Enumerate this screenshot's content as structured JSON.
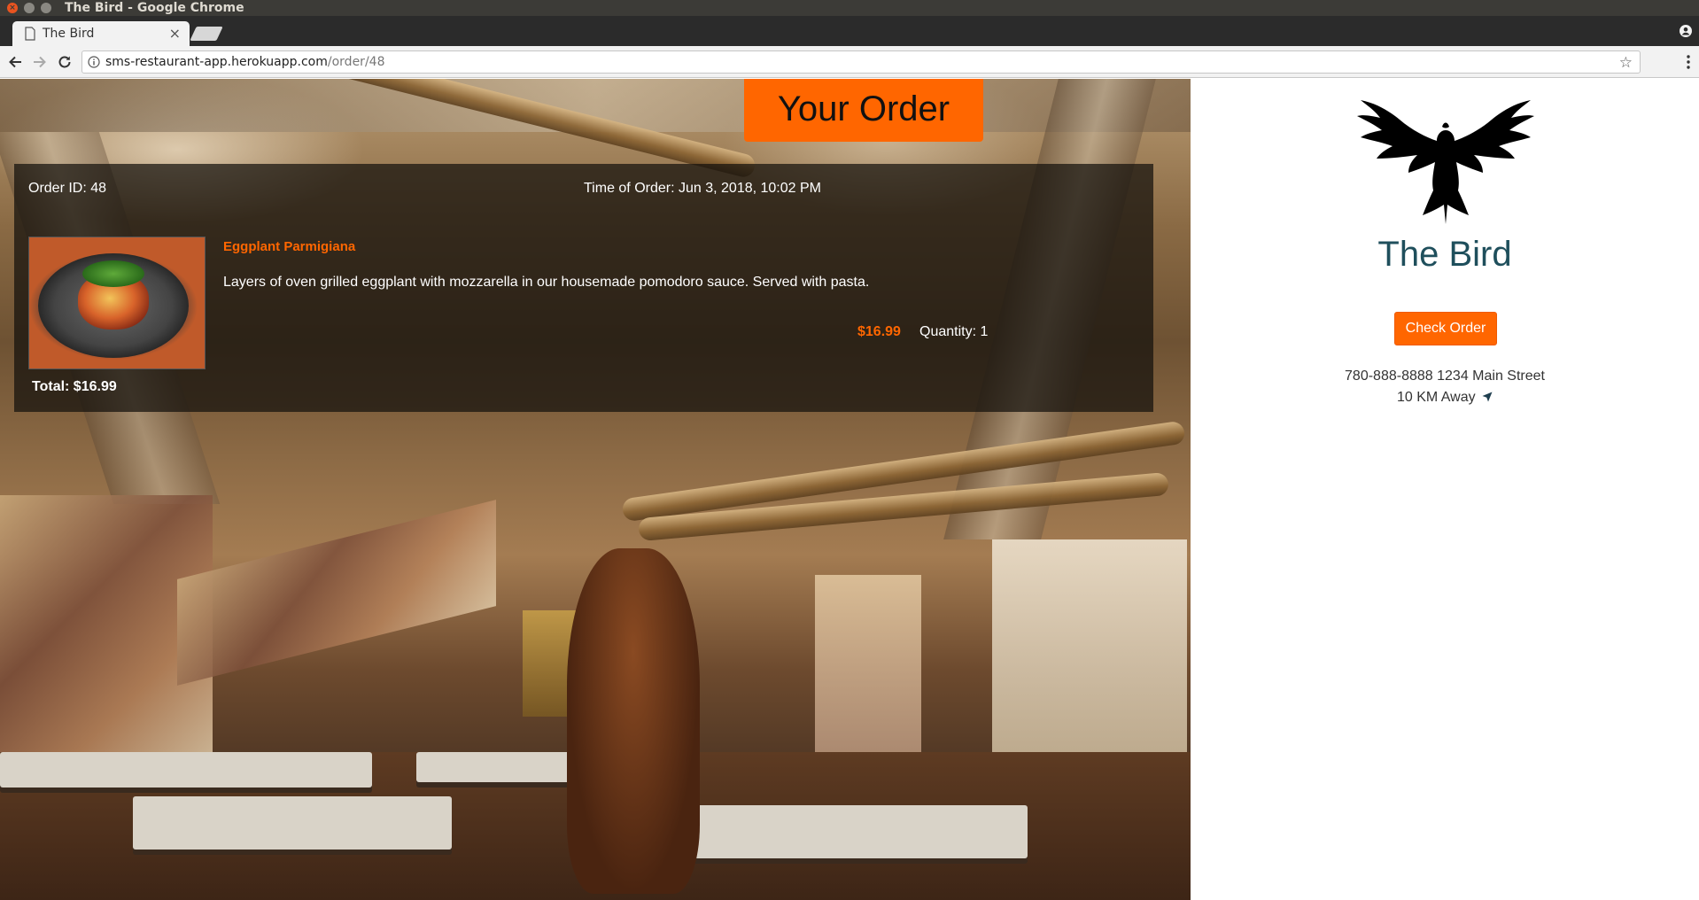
{
  "window": {
    "title": "The Bird - Google Chrome"
  },
  "browser": {
    "tab_title": "The Bird",
    "tab_close": "×",
    "url_host": "sms-restaurant-app.herokuapp.com",
    "url_path": "/order/48",
    "star": "☆"
  },
  "hero": {
    "button_label": "Your Order"
  },
  "order": {
    "id_label": "Order ID: 48",
    "time_label": "Time of Order: Jun 3, 2018, 10:02 PM",
    "items": [
      {
        "name": "Eggplant Parmigiana",
        "description": "Layers of oven grilled eggplant with mozzarella in our housemade pomodoro sauce. Served with pasta.",
        "price": "$16.99",
        "quantity": "Quantity: 1"
      }
    ],
    "total": "Total: $16.99"
  },
  "sidebar": {
    "brand": "The Bird",
    "check_order_label": "Check Order",
    "address": "780-888-8888 1234 Main Street",
    "distance": "10 KM Away"
  },
  "colors": {
    "accent": "#ff6600",
    "brand_text": "#1f4f5c"
  }
}
